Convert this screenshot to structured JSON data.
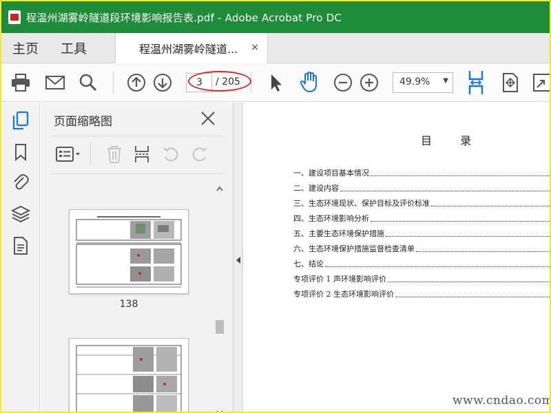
{
  "window": {
    "title": "程温州湖雾岭隧道段环境影响报告表.pdf - Adobe Acrobat Pro DC"
  },
  "tabs": {
    "home": "主页",
    "tools": "工具",
    "document_tab": "程温州湖雾岭隧道...",
    "close_symbol": "×"
  },
  "toolbar": {
    "current_page": "3",
    "page_total": "/ 205",
    "zoom": "49.9%",
    "icons": [
      "print-icon",
      "email-icon",
      "search-icon",
      "page-up-icon",
      "page-down-icon",
      "select-cursor-icon",
      "hand-tool-icon",
      "zoom-out-icon",
      "zoom-in-icon",
      "fit-width-icon",
      "fit-page-icon",
      "full-screen-icon"
    ]
  },
  "sidebar": {
    "icons": [
      "page-thumbnails-icon",
      "bookmarks-icon",
      "attachments-icon",
      "layers-icon",
      "content-icon"
    ],
    "panel_title": "页面缩略图",
    "panel_tools": [
      "thumbnail-options-icon",
      "delete-icon",
      "extract-icon",
      "rotate-left-icon",
      "rotate-right-icon"
    ],
    "thumbnails": [
      {
        "label": "138"
      },
      {
        "label": ""
      }
    ]
  },
  "document": {
    "heading": "目 录",
    "toc": [
      "一、建设项目基本情况",
      "二、建设内容",
      "三、生态环境现状、保护目标及评价标准",
      "四、生态环境影响分析",
      "五、主要生态环境保护措施",
      "六、生态环境保护措施监督检查清单",
      "七、结论",
      "专项评价 1 声环境影响评价",
      "专项评价 2 生态环境影响评价"
    ]
  },
  "watermark": "www.cndao.com",
  "colors": {
    "title_bar": "#1e8c38",
    "accent_blue": "#1473e6",
    "annotation_red": "#e0272b",
    "frame_yellow": "#f5e53a"
  }
}
